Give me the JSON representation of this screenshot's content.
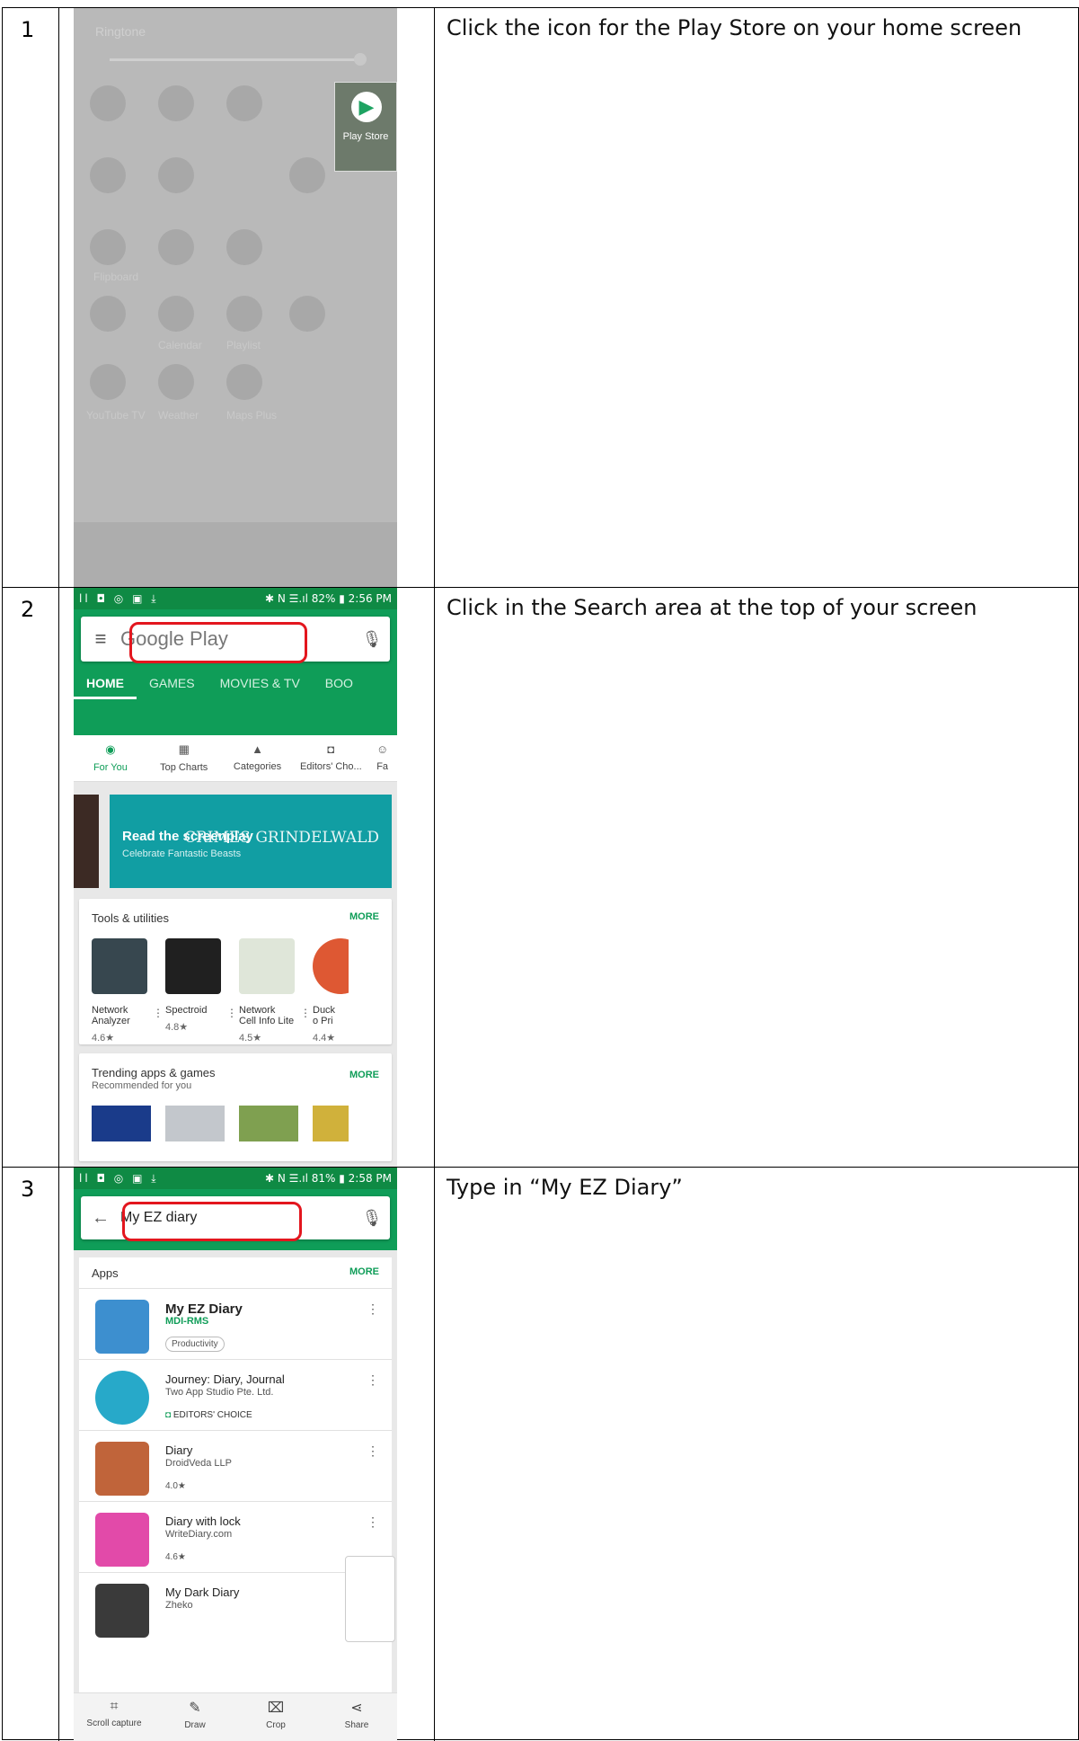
{
  "rows": [
    {
      "number": "1",
      "instruction": "Click the icon for the Play Store on your home screen",
      "screen": {
        "ringtone_label": "Ringtone",
        "play_tile_label": "Play Store",
        "grid_labels": [
          "Flipboard",
          "Calendar",
          "Playlist",
          "YouTube TV",
          "Weather",
          "Maps Plus"
        ]
      }
    },
    {
      "number": "2",
      "instruction": "Click in the Search area at the top of your screen",
      "screen": {
        "status_left": "ll ◘ ◎ ▣ ⤓",
        "status_right": "✱ Ν ☰.ıl 82% ▮ 2:56 PM",
        "search_placeholder": "Google Play",
        "tabs": [
          "HOME",
          "GAMES",
          "MOVIES & TV",
          "BOO"
        ],
        "subnav": [
          {
            "label": "For You",
            "icon": "compass-icon"
          },
          {
            "label": "Top Charts",
            "icon": "chart-icon"
          },
          {
            "label": "Categories",
            "icon": "shapes-icon"
          },
          {
            "label": "Editors' Cho...",
            "icon": "badge-icon"
          },
          {
            "label": "Fa",
            "icon": "family-icon"
          }
        ],
        "banner": {
          "title": "Read the screenplay",
          "subtitle": "Celebrate Fantastic Beasts",
          "artwork_text": "CRIMES GRINDELWALD"
        },
        "tools_card": {
          "title": "Tools & utilities",
          "more": "MORE",
          "apps": [
            {
              "name": "Network\nAnalyzer",
              "rating": "4.6★"
            },
            {
              "name": "Spectroid",
              "rating": "4.8★"
            },
            {
              "name": "Network\nCell Info Lite",
              "rating": "4.5★"
            },
            {
              "name": "Duck\no Pri",
              "rating": "4.4★"
            }
          ]
        },
        "trending_card": {
          "title": "Trending apps & games",
          "subtitle": "Recommended for you",
          "more": "MORE"
        }
      }
    },
    {
      "number": "3",
      "instruction": "Type in “My EZ Diary”",
      "screen": {
        "status_left": "ll ◘ ◎ ▣ ⤓",
        "status_right": "✱ Ν ☰.ıl 81% ▮ 2:58 PM",
        "search_value": "My EZ diary",
        "section": "Apps",
        "more": "MORE",
        "results": [
          {
            "name": "My EZ Diary",
            "dev": "MDI-RMS",
            "extra": "Productivity"
          },
          {
            "name": "Journey: Diary, Journal",
            "dev": "Two App Studio Pte. Ltd.",
            "extra": "EDITORS' CHOICE"
          },
          {
            "name": "Diary",
            "dev": "DroidVeda LLP",
            "extra": "4.0★"
          },
          {
            "name": "Diary with lock",
            "dev": "WriteDiary.com",
            "extra": "4.6★"
          },
          {
            "name": "My Dark Diary",
            "dev": "Zheko",
            "extra": ""
          }
        ],
        "capture_bar": [
          "Scroll capture",
          "Draw",
          "Crop",
          "Share"
        ]
      }
    }
  ],
  "colors": {
    "play_green": "#0f9d58",
    "highlight_red": "#e3161e"
  }
}
